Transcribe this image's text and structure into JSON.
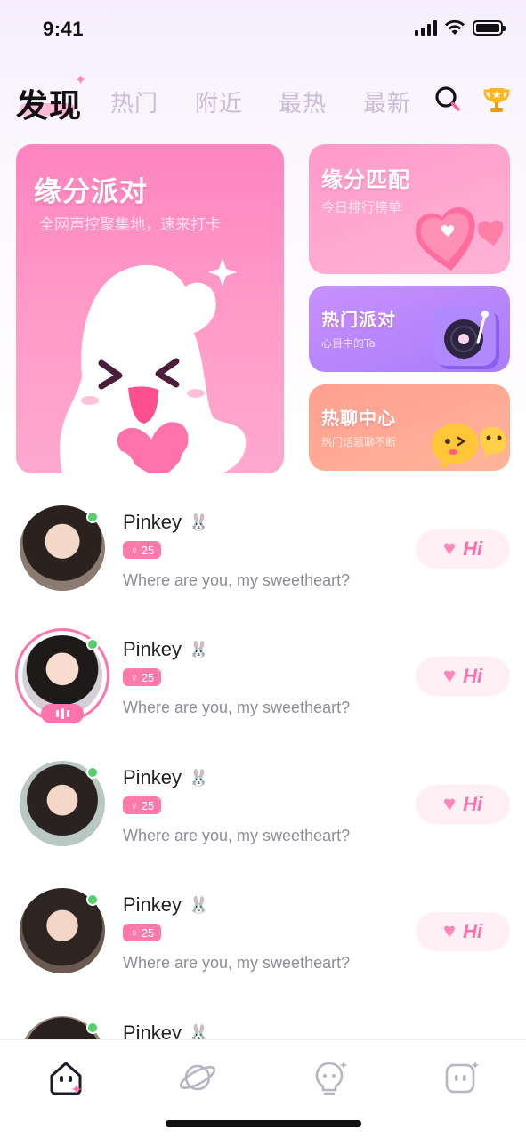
{
  "status_bar": {
    "time": "9:41"
  },
  "nav": {
    "active_tab": "发现",
    "tabs": [
      "热门",
      "附近",
      "最热",
      "最新"
    ],
    "icons": [
      "search-icon",
      "trophy-icon"
    ]
  },
  "cards": {
    "party": {
      "title": "缘分派对",
      "subtitle": "全网声控聚集地，速来打卡"
    },
    "match": {
      "title": "缘分匹配",
      "subtitle": "今日排行榜单"
    },
    "hot_party": {
      "title": "热门派对",
      "subtitle": "心目中的Ta"
    },
    "chat_center": {
      "title": "热聊中心",
      "subtitle": "热门话题聊不断"
    }
  },
  "users": [
    {
      "name": "Pinkey",
      "age": "25",
      "message": "Where are you, my sweetheart?",
      "hi": "Hi",
      "online": true,
      "live": false
    },
    {
      "name": "Pinkey",
      "age": "25",
      "message": "Where are you, my sweetheart?",
      "hi": "Hi",
      "online": true,
      "live": true
    },
    {
      "name": "Pinkey",
      "age": "25",
      "message": "Where are you, my sweetheart?",
      "hi": "Hi",
      "online": true,
      "live": false
    },
    {
      "name": "Pinkey",
      "age": "25",
      "message": "Where are you, my sweetheart?",
      "hi": "Hi",
      "online": true,
      "live": false
    },
    {
      "name": "Pinkey",
      "age": "",
      "message": "",
      "hi": "",
      "online": true,
      "live": false
    }
  ],
  "tabbar": {
    "items": [
      "home-icon",
      "planet-icon",
      "bulb-icon",
      "chat-icon"
    ],
    "active": "home-icon"
  },
  "colors": {
    "accent_pink": "#ff6fa8",
    "online_green": "#4fd068",
    "tab_inactive": "#c9bcd8"
  }
}
